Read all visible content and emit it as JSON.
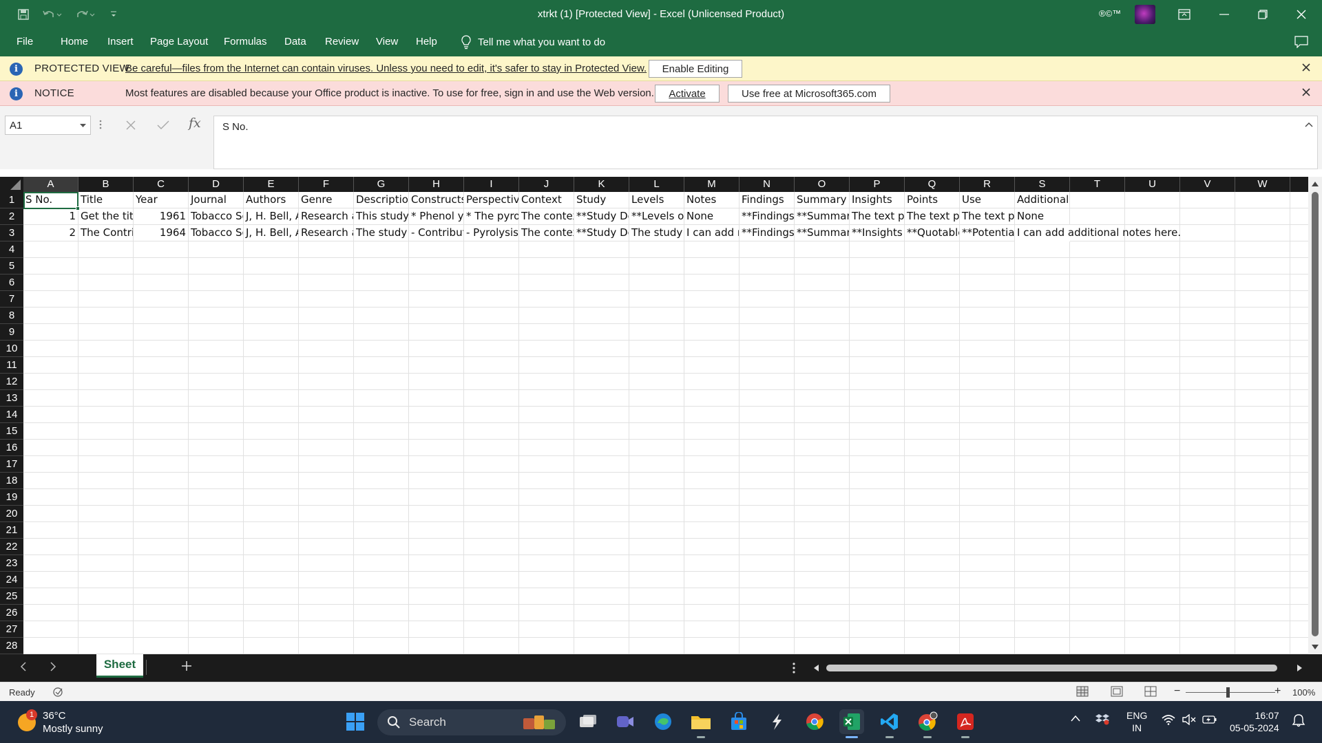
{
  "window": {
    "title": "xtrkt (1)  [Protected View]  -  Excel (Unlicensed Product)",
    "badges": "®©™"
  },
  "menu": {
    "tabs": [
      "File",
      "Home",
      "Insert",
      "Page Layout",
      "Formulas",
      "Data",
      "Review",
      "View",
      "Help"
    ],
    "tell_me": "Tell me what you want to do"
  },
  "protected_view": {
    "head": "PROTECTED VIEW",
    "message": "Be careful—files from the Internet can contain viruses. Unless you need to edit, it's safer to stay in Protected View.",
    "button": "Enable Editing"
  },
  "notice": {
    "head": "NOTICE",
    "message": "Most features are disabled because your Office product is inactive. To use for free, sign in and use the Web version.",
    "activate": "Activate",
    "use_free": "Use free at Microsoft365.com"
  },
  "formula_bar": {
    "name_box": "A1",
    "fx": "fx",
    "value": "S No."
  },
  "grid": {
    "columns": [
      "A",
      "B",
      "C",
      "D",
      "E",
      "F",
      "G",
      "H",
      "I",
      "J",
      "K",
      "L",
      "M",
      "N",
      "O",
      "P",
      "Q",
      "R",
      "S",
      "T",
      "U",
      "V",
      "W"
    ],
    "rows": [
      "1",
      "2",
      "3",
      "4",
      "5",
      "6",
      "7",
      "8",
      "9",
      "10",
      "11",
      "12",
      "13",
      "14",
      "15",
      "16",
      "17",
      "18",
      "19",
      "20",
      "21",
      "22",
      "23",
      "24",
      "25",
      "26",
      "27",
      "28"
    ],
    "data": [
      [
        "S No.",
        "Title",
        "Year",
        "Journal",
        "Authors",
        "Genre",
        "Description",
        "Constructs",
        "Perspective",
        "Context",
        "Study",
        "Levels",
        "Notes",
        "Findings",
        "Summary",
        "Insights",
        "Points",
        "Use",
        "Additional"
      ],
      [
        "1",
        "Get the title",
        "1961",
        "Tobacco Science",
        "J, H. Bell, A",
        "Research article",
        "This study",
        "* Phenol y",
        "* The pyro",
        "The context",
        "**Study Design",
        "**Levels of",
        "None",
        "**Findings",
        "**Summary",
        "The text pr",
        "The text pr",
        "The text pr",
        "None"
      ],
      [
        "2",
        "The Contribution",
        "1964",
        "Tobacco Science",
        "J, H. Bell, A",
        "Research article",
        "The study i",
        "- Contribut",
        "- Pyrolysis",
        "The context",
        "**Study Design",
        "The study c",
        "I can add n",
        "**Findings",
        "**Summary",
        "**Insights",
        "**Quotable",
        "**Potential",
        "I can add additional notes here."
      ]
    ]
  },
  "sheets": {
    "tabs": [
      "Sheet"
    ],
    "active": "Sheet"
  },
  "status": {
    "ready": "Ready",
    "zoom": "100%",
    "zoom_minus": "−",
    "zoom_plus": "+"
  },
  "taskbar": {
    "weather_temp": "36°C",
    "weather_desc": "Mostly sunny",
    "weather_badge": "1",
    "search": "Search",
    "lang_line1": "ENG",
    "lang_line2": "IN",
    "time": "16:07",
    "date": "05-05-2024"
  },
  "colors": {
    "excel_green": "#1e6b41",
    "protected_bg": "#fdf6c9",
    "notice_bg": "#fbdcdb",
    "taskbar_bg": "#1f2a3a"
  }
}
